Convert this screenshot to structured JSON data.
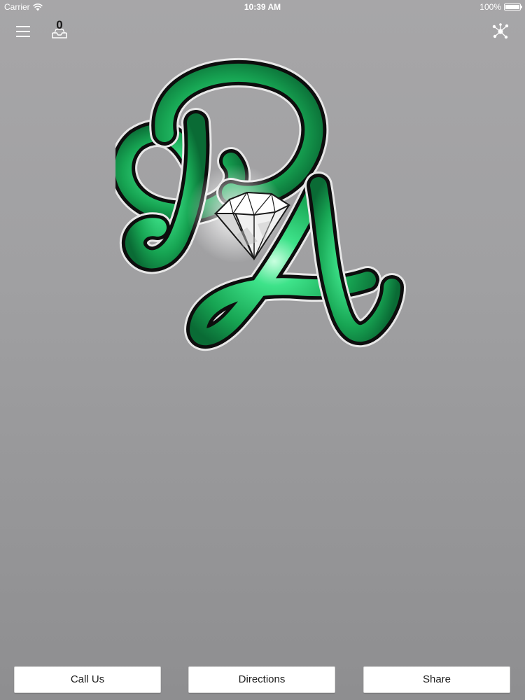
{
  "status_bar": {
    "carrier": "Carrier",
    "time": "10:39 AM",
    "battery": "100%",
    "battery_level": 1.0
  },
  "nav": {
    "inbox_count": "0",
    "menu_icon": "hamburger-menu-icon",
    "inbox_icon": "inbox-tray-icon",
    "share_icon": "network-share-icon"
  },
  "logo": {
    "letters": "PA",
    "icon": "diamond-icon",
    "colors": {
      "green_dark": "#0a6b35",
      "green_light": "#3ee38a",
      "outline": "#0d0d0d"
    }
  },
  "actions": {
    "call_label": "Call Us",
    "directions_label": "Directions",
    "share_label": "Share"
  },
  "colors": {
    "background_top": "#a7a6a8",
    "background_bottom": "#8e8e90",
    "button_bg": "#ffffff",
    "button_text": "#1c1c1c"
  }
}
